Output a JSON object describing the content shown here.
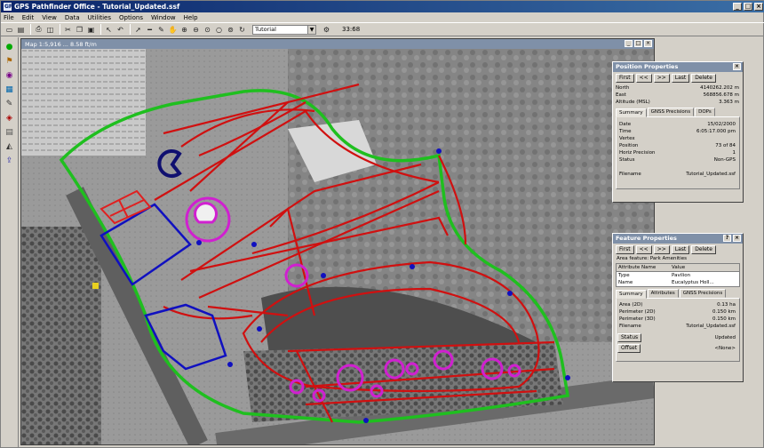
{
  "window": {
    "title": "GPS Pathfinder Office - Tutorial_Updated.ssf",
    "icon_text": "GPS"
  },
  "menu": [
    "File",
    "Edit",
    "View",
    "Data",
    "Utilities",
    "Options",
    "Window",
    "Help"
  ],
  "toolbar": {
    "layer_value": "Tutorial",
    "scale_value": "33:68"
  },
  "map": {
    "title": "Map 1:5,916 ... 8.58 ft/m"
  },
  "position_panel": {
    "title": "Position Properties",
    "buttons": [
      "First",
      "<<",
      ">>",
      "Last",
      "Delete"
    ],
    "north_label": "North",
    "north_value": "4140262.202 m",
    "east_label": "East",
    "east_value": "568856.678 m",
    "alt_label": "Altitude (MSL)",
    "alt_value": "3.363 m",
    "tabs": [
      "Summary",
      "GNSS Precisions",
      "DOPs"
    ],
    "rows": [
      {
        "k": "Date",
        "v": "15/02/2000"
      },
      {
        "k": "Time",
        "v": "6:05:17.000 pm"
      },
      {
        "k": "Vertex",
        "v": ""
      },
      {
        "k": "Position",
        "v": "73 of 84"
      },
      {
        "k": "Horiz Precision",
        "v": "1"
      },
      {
        "k": "Status",
        "v": "Non-GPS"
      }
    ],
    "filename_label": "Filename",
    "filename_value": "Tutorial_Updated.ssf"
  },
  "feature_panel": {
    "title": "Feature Properties",
    "buttons": [
      "First",
      "<<",
      ">>",
      "Last",
      "Delete"
    ],
    "feature_label": "Area feature: Park Amenities",
    "grid_headers": [
      "Attribute Name",
      "Value"
    ],
    "grid_rows": [
      {
        "name": "Type",
        "value": "Pavilion"
      },
      {
        "name": "Name",
        "value": "Eucalyptus Holl..."
      }
    ],
    "tabs": [
      "Summary",
      "Attributes",
      "GNSS Precisions"
    ],
    "rows": [
      {
        "k": "Area (2D)",
        "v": "0.13 ha"
      },
      {
        "k": "Perimeter (2D)",
        "v": "0.150 km"
      },
      {
        "k": "Perimeter (3D)",
        "v": "0.150 km"
      },
      {
        "k": "Filename",
        "v": "Tutorial_Updated.ssf"
      }
    ],
    "status_btn": "Status",
    "status_value": "Updated",
    "offset_btn": "Offset",
    "offset_value": "<None>"
  },
  "colors": {
    "boundary": "#1fbf1f",
    "roads": "#d01010",
    "fields": "#1010c0",
    "amenities": "#d020d0",
    "titlebar": "#0a246a"
  }
}
